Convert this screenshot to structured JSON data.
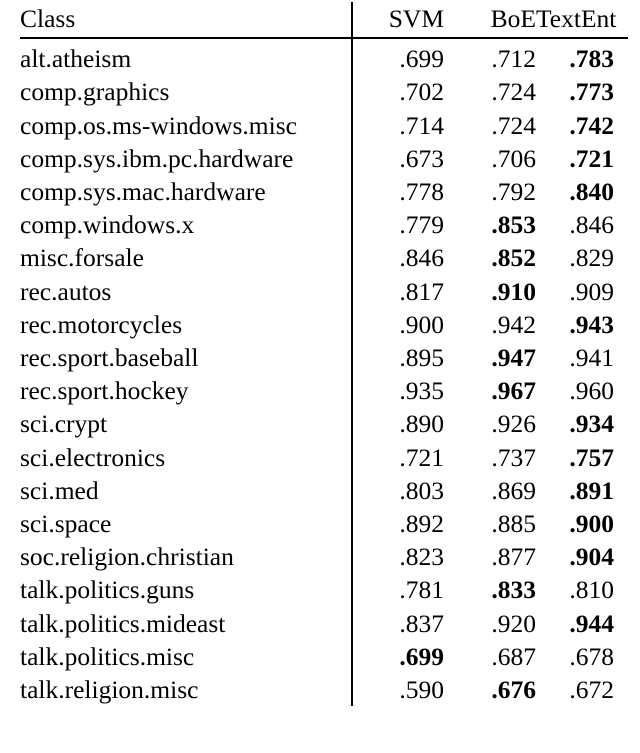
{
  "table": {
    "columns": [
      {
        "key": "class",
        "label": "Class",
        "align": "left"
      },
      {
        "key": "svm",
        "label": "SVM",
        "align": "right"
      },
      {
        "key": "boe",
        "label": "BoE",
        "align": "right"
      },
      {
        "key": "textent",
        "label": "TextEnt",
        "align": "right"
      }
    ],
    "rows": [
      {
        "class": "alt.atheism",
        "svm": ".699",
        "boe": ".712",
        "textent": ".783",
        "bold": "textent"
      },
      {
        "class": "comp.graphics",
        "svm": ".702",
        "boe": ".724",
        "textent": ".773",
        "bold": "textent"
      },
      {
        "class": "comp.os.ms-windows.misc",
        "svm": ".714",
        "boe": ".724",
        "textent": ".742",
        "bold": "textent"
      },
      {
        "class": "comp.sys.ibm.pc.hardware",
        "svm": ".673",
        "boe": ".706",
        "textent": ".721",
        "bold": "textent"
      },
      {
        "class": "comp.sys.mac.hardware",
        "svm": ".778",
        "boe": ".792",
        "textent": ".840",
        "bold": "textent"
      },
      {
        "class": "comp.windows.x",
        "svm": ".779",
        "boe": ".853",
        "textent": ".846",
        "bold": "boe"
      },
      {
        "class": "misc.forsale",
        "svm": ".846",
        "boe": ".852",
        "textent": ".829",
        "bold": "boe"
      },
      {
        "class": "rec.autos",
        "svm": ".817",
        "boe": ".910",
        "textent": ".909",
        "bold": "boe"
      },
      {
        "class": "rec.motorcycles",
        "svm": ".900",
        "boe": ".942",
        "textent": ".943",
        "bold": "textent"
      },
      {
        "class": "rec.sport.baseball",
        "svm": ".895",
        "boe": ".947",
        "textent": ".941",
        "bold": "boe"
      },
      {
        "class": "rec.sport.hockey",
        "svm": ".935",
        "boe": ".967",
        "textent": ".960",
        "bold": "boe"
      },
      {
        "class": "sci.crypt",
        "svm": ".890",
        "boe": ".926",
        "textent": ".934",
        "bold": "textent"
      },
      {
        "class": "sci.electronics",
        "svm": ".721",
        "boe": ".737",
        "textent": ".757",
        "bold": "textent"
      },
      {
        "class": "sci.med",
        "svm": ".803",
        "boe": ".869",
        "textent": ".891",
        "bold": "textent"
      },
      {
        "class": "sci.space",
        "svm": ".892",
        "boe": ".885",
        "textent": ".900",
        "bold": "textent"
      },
      {
        "class": "soc.religion.christian",
        "svm": ".823",
        "boe": ".877",
        "textent": ".904",
        "bold": "textent"
      },
      {
        "class": "talk.politics.guns",
        "svm": ".781",
        "boe": ".833",
        "textent": ".810",
        "bold": "boe"
      },
      {
        "class": "talk.politics.mideast",
        "svm": ".837",
        "boe": ".920",
        "textent": ".944",
        "bold": "textent"
      },
      {
        "class": "talk.politics.misc",
        "svm": ".699",
        "boe": ".687",
        "textent": ".678",
        "bold": "svm"
      },
      {
        "class": "talk.religion.misc",
        "svm": ".590",
        "boe": ".676",
        "textent": ".672",
        "bold": "boe"
      }
    ]
  },
  "caption": {
    "clipped_text": ""
  },
  "colors": {
    "text": "#000000",
    "rule": "#000000",
    "background": "#ffffff"
  }
}
